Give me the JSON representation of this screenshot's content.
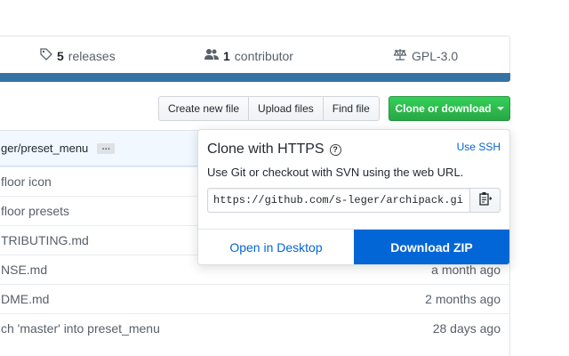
{
  "summary": {
    "releases_count": "5",
    "releases_label": "releases",
    "contributors_count": "1",
    "contributors_label": "contributor",
    "license": "GPL-3.0"
  },
  "toolbar": {
    "create_label": "Create new file",
    "upload_label": "Upload files",
    "find_label": "Find file",
    "clone_label": "Clone or download"
  },
  "commit": {
    "branch_text": "ger/preset_menu",
    "ellipsis": "…"
  },
  "files": [
    {
      "name": "floor icon",
      "age": ""
    },
    {
      "name": "floor presets",
      "age": ""
    },
    {
      "name": "TRIBUTING.md",
      "age": ""
    },
    {
      "name": "NSE.md",
      "age": "a month ago"
    },
    {
      "name": "DME.md",
      "age": "2 months ago"
    },
    {
      "name": "ch 'master' into preset_menu",
      "age": "28 days ago"
    }
  ],
  "clone_dropdown": {
    "title": "Clone with HTTPS",
    "help_glyph": "?",
    "use_ssh": "Use SSH",
    "description": "Use Git or checkout with SVN using the web URL.",
    "url": "https://github.com/s-leger/archipack.git",
    "open_desktop": "Open in Desktop",
    "download_zip": "Download ZIP"
  },
  "colors": {
    "accent_green": "#28a745",
    "link_blue": "#0366d6",
    "language_bar": "#3572A5"
  }
}
